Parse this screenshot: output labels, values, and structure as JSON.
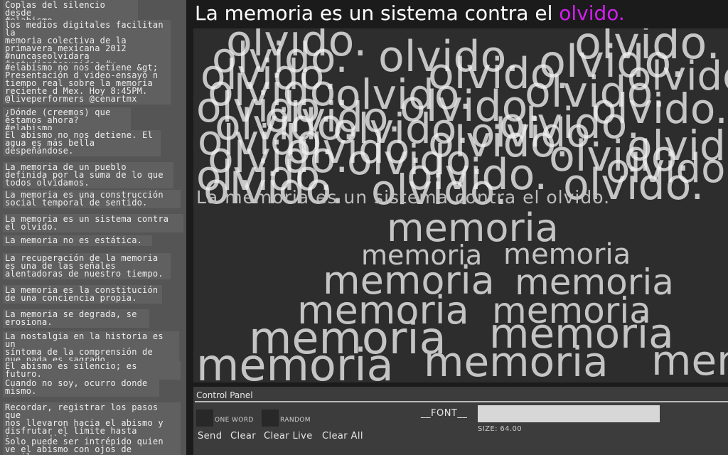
{
  "header": {
    "text": "La memoria es un sistema contra el ",
    "highlight": "olvido.",
    "highlight_color": "#d21ef0"
  },
  "feed": [
    "Coplas del silencio desde\n#elabismo.",
    "los medios digitales facilitan la\nmemoria colectiva de la\nprimavera mexicana 2012\n#nuncaseolvidara\n#estudiantesunidos #y ...",
    "#elabismo no nos detiene &gt;\nPresentación d video-ensayo n\ntiempo real sobre la memoria\nreciente d Mex. Hoy 8:45PM.\n@liveperformers @cenartmx",
    "¿Dónde (creemos) que\nestamos ahora? #elabismo",
    "El abismo no nos detiene. El\nagua es más bella\ndespeñándose.",
    "La memoria de un pueblo\ndefinida por la suma de lo que\ntodos olvidamos.",
    "La memoria es una construcción\nsocial temporal de sentido.",
    "La memoria es un sistema contra\nel olvido.",
    "La memoria no es estática.",
    "La recuperación de la memoria\nes una de las señales\nalentadoras de nuestro tiempo.",
    "La memoria es la constitución\nde una conciencia propia.",
    "La memoria se degrada, se\nerosiona.",
    "La nostalgia en la historia es un\nsíntoma de la comprensión de\nque nada es sagrado.",
    "El abismo es silencio; es futuro.",
    "Cuando no soy, ocurro donde\nmismo.",
    "Recordar, registrar los pasos que\nnos llevaron hacia el abismo y\ndisfrutar el límite hasta\ntransgredirlo.",
    "Solo puede ser intrépido quien\nve el abismo con ojos de\naguila..."
  ],
  "canvas": {
    "olvido_word": "olvido.",
    "caption": "La memoria es un sistema contra el olvido.",
    "memoria_word": "memoria"
  },
  "panel": {
    "title": "Control Panel",
    "one_word": "ONE WORD",
    "random": "RANDOM",
    "font_label": "__FONT__",
    "font_value": "",
    "size_label": "SIZE: 64.00",
    "buttons": [
      "Send",
      "Clear",
      "Clear Live",
      "Clear All"
    ]
  }
}
